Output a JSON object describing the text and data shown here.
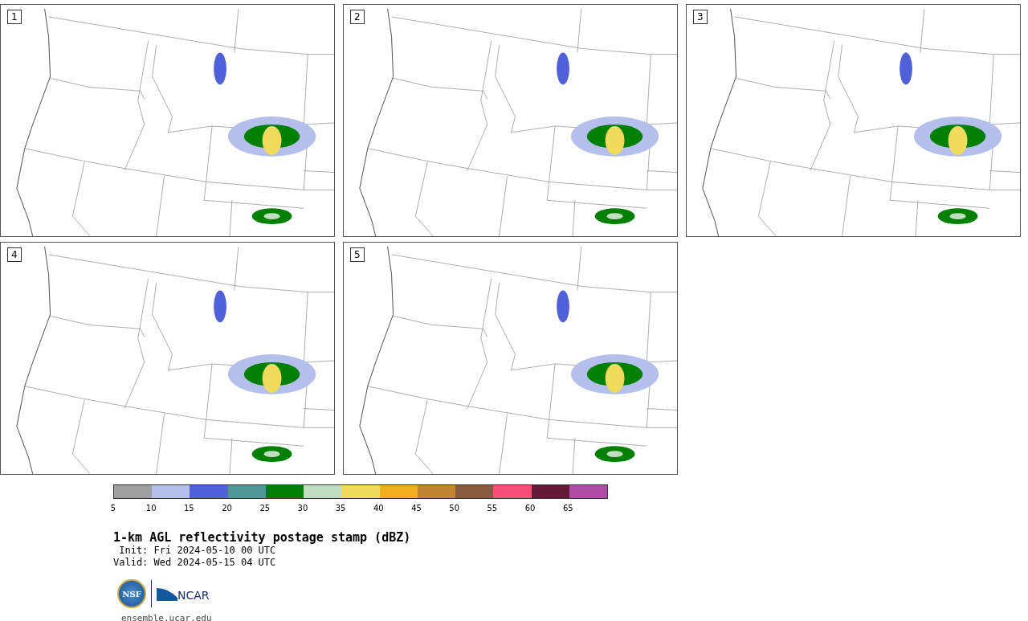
{
  "panels": [
    {
      "label": "1"
    },
    {
      "label": "2"
    },
    {
      "label": "3"
    },
    {
      "label": "4"
    },
    {
      "label": "5"
    }
  ],
  "colorbar": {
    "bins": [
      {
        "color": "#a0a0a0"
      },
      {
        "color": "#b4bfeb"
      },
      {
        "color": "#5060d8"
      },
      {
        "color": "#4f9699"
      },
      {
        "color": "#008000"
      },
      {
        "color": "#c0dfc0"
      },
      {
        "color": "#f0dc5a"
      },
      {
        "color": "#f0ae1a"
      },
      {
        "color": "#c0852e"
      },
      {
        "color": "#8b5a3c"
      },
      {
        "color": "#f45078"
      },
      {
        "color": "#641a37"
      },
      {
        "color": "#b04ca8"
      }
    ],
    "ticks": [
      "5",
      "10",
      "15",
      "20",
      "25",
      "30",
      "35",
      "40",
      "45",
      "50",
      "55",
      "60",
      "65"
    ]
  },
  "title": "1-km AGL reflectivity postage stamp (dBZ)",
  "init": " Init: Fri 2024-05-10 00 UTC",
  "valid": "Valid: Wed 2024-05-15 04 UTC",
  "logo": {
    "seal_text": "NSF",
    "wordmark": "NCAR"
  },
  "site": "ensemble.ucar.edu"
}
